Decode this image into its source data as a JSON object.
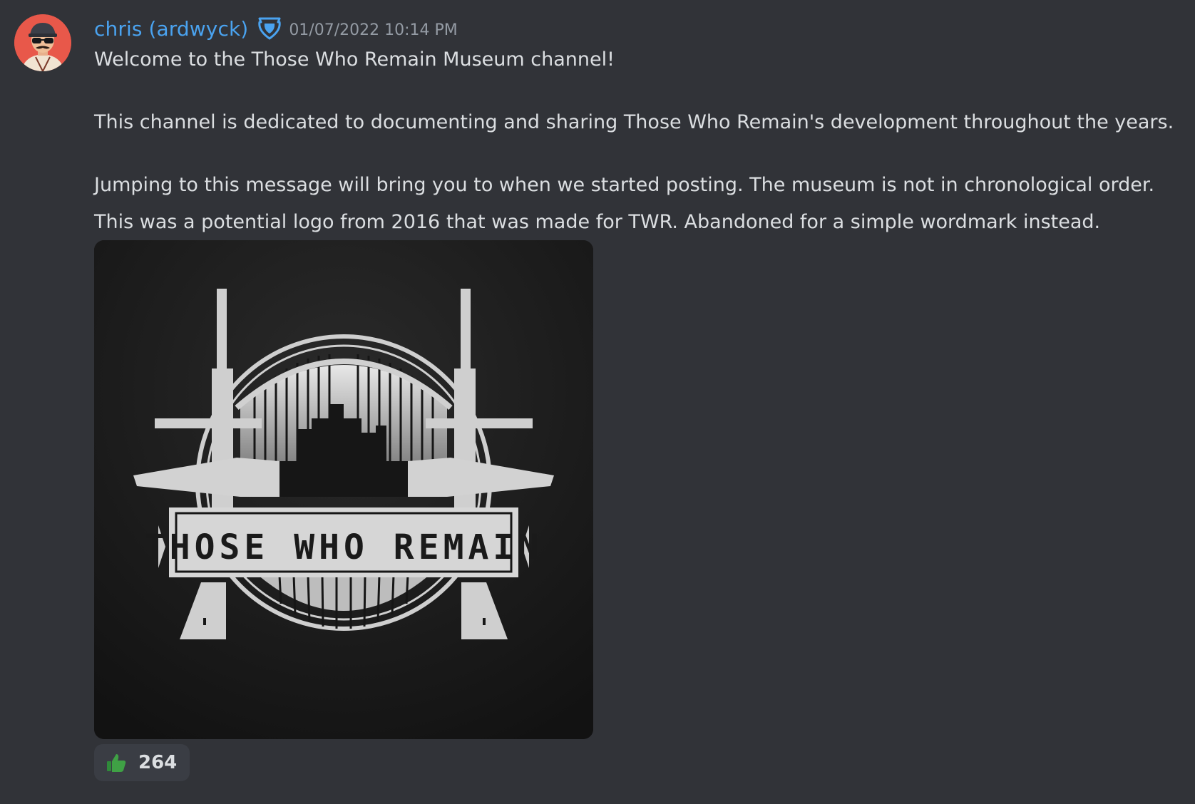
{
  "message": {
    "author": {
      "display_name": "chris (ardwyck)",
      "avatar_icon": "avatar-portrait",
      "name_color": "#4aa3f0",
      "role_icon": "moderator-shield-icon"
    },
    "timestamp": "01/07/2022 10:14 PM",
    "lines": [
      "Welcome to the Those Who Remain Museum channel!",
      "This channel is dedicated to documenting and sharing Those Who Remain's development throughout the years.",
      "Jumping to this message will bring you to when we started posting. The museum is not in chronological order.",
      "This was a potential logo from 2016 that was made for TWR. Abandoned for a simple wordmark instead."
    ],
    "attachment": {
      "logo_text": "THOSE WHO REMAIN"
    },
    "reaction": {
      "emoji": "thumbs-up-icon",
      "count": "264",
      "emoji_color": "#3fa145"
    }
  }
}
